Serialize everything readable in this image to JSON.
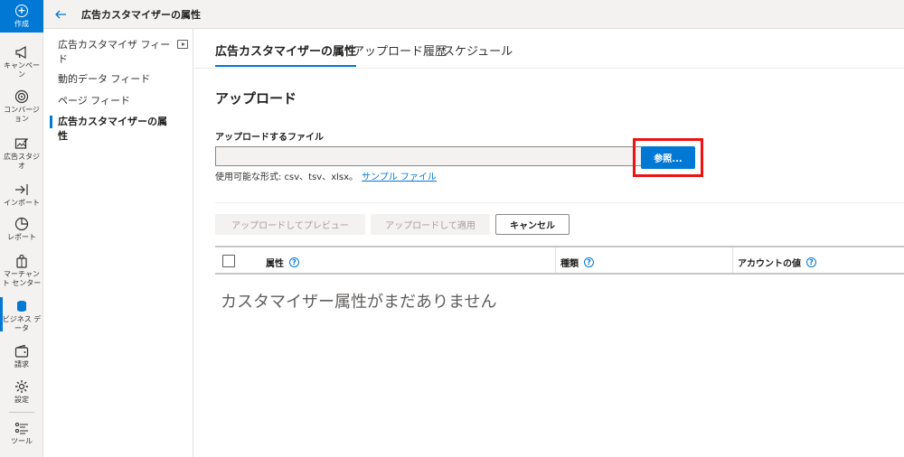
{
  "rail": {
    "create_label": "作成",
    "items": [
      {
        "label": "キャンペー\nン",
        "icon": "megaphone-icon"
      },
      {
        "label": "コンバージ\nョン",
        "icon": "target-icon"
      },
      {
        "label": "広告スタジ\nオ",
        "icon": "image-edit-icon"
      },
      {
        "label": "インポート",
        "icon": "import-icon"
      },
      {
        "label": "レポート",
        "icon": "pie-chart-icon"
      },
      {
        "label": "マーチャン\nト センター",
        "icon": "shopping-bag-icon"
      },
      {
        "label": "ビジネス デ\nータ",
        "icon": "database-icon"
      },
      {
        "label": "請求",
        "icon": "wallet-icon"
      },
      {
        "label": "設定",
        "icon": "gear-icon"
      },
      {
        "label": "ツール",
        "icon": "tools-list-icon"
      }
    ]
  },
  "header": {
    "title": "広告カスタマイザーの属性"
  },
  "subnav": {
    "items": [
      {
        "label": "広告カスタマイザ フィード"
      },
      {
        "label": "動的データ フィード"
      },
      {
        "label": "ページ フィード"
      },
      {
        "label": "広告カスタマイザーの属性"
      }
    ]
  },
  "tabs": [
    {
      "label": "広告カスタマイザーの属性"
    },
    {
      "label": "アップロード履歴"
    },
    {
      "label": "スケジュール"
    }
  ],
  "upload": {
    "title": "アップロード",
    "file_label": "アップロードするファイル",
    "file_value": "",
    "browse_label": "参照...",
    "formats_text": "使用可能な形式: csv、tsv、xlsx。",
    "sample_link": "サンプル ファイル"
  },
  "actions": {
    "preview_label": "アップロードしてプレビュー",
    "apply_label": "アップロードして適用",
    "cancel_label": "キャンセル"
  },
  "table": {
    "columns": [
      {
        "label": "属性"
      },
      {
        "label": "種類"
      },
      {
        "label": "アカウントの値"
      }
    ],
    "empty_text": "カスタマイザー属性がまだありません"
  },
  "colors": {
    "accent": "#0078d4",
    "highlight": "#ee1111"
  }
}
